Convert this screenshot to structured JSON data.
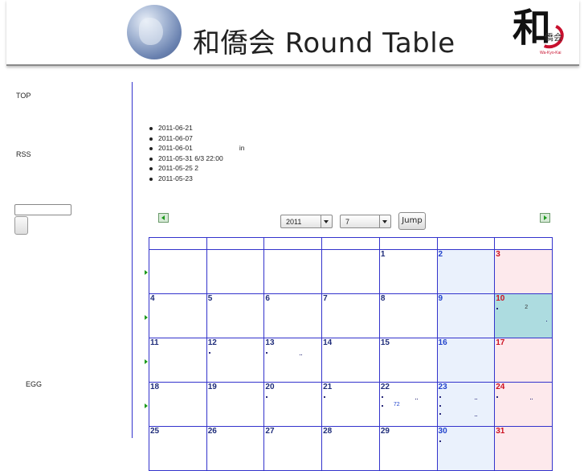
{
  "header": {
    "title": "和僑会 Round Table",
    "logo_mark": "和",
    "logo_sub": "僑会",
    "logo_tag": "Wa-Kyo-Kai"
  },
  "sidebar": {
    "top_label": "TOP",
    "rss_label": "RSS",
    "search_value": "",
    "egg_label": "EGG"
  },
  "news": [
    {
      "date": "2011-06-21",
      "text": ""
    },
    {
      "date": "2011-06-07",
      "text": ""
    },
    {
      "date": "2011-06-01",
      "text": "in"
    },
    {
      "date": "2011-05-31",
      "text": "6/3 22:00"
    },
    {
      "date": "2011-05-25",
      "text": "2"
    },
    {
      "date": "2011-05-23",
      "text": ""
    }
  ],
  "calendar": {
    "year_value": "2011",
    "month_value": "7",
    "jump_label": "Jump",
    "weeks": [
      [
        "",
        "",
        "",
        "",
        "1",
        "2",
        "3"
      ],
      [
        "4",
        "5",
        "6",
        "7",
        "8",
        "9",
        "10"
      ],
      [
        "11",
        "12",
        "13",
        "14",
        "15",
        "16",
        "17"
      ],
      [
        "18",
        "19",
        "20",
        "21",
        "22",
        "23",
        "24"
      ],
      [
        "25",
        "26",
        "27",
        "28",
        "29",
        "30",
        "31"
      ]
    ],
    "events": {
      "d10": "2",
      "d22": "72"
    }
  },
  "colors": {
    "grid": "#3333cc",
    "saturday_bg": "#eaf1fc",
    "sunday_bg": "#fde9ec",
    "today_bg": "#addce0"
  }
}
